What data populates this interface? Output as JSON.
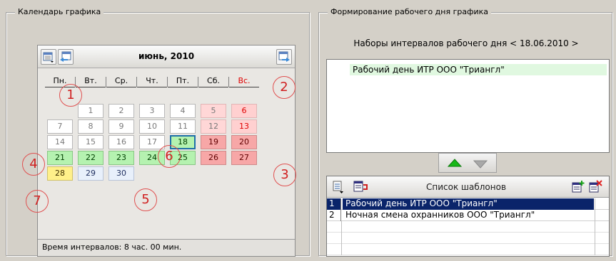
{
  "calendar": {
    "group_title": "Календарь графика",
    "month_title": "июнь, 2010",
    "weekdays": [
      "Пн.",
      "Вт.",
      "Ср.",
      "Чт.",
      "Пт.",
      "Сб.",
      "Вс."
    ],
    "days": [
      {
        "label": "1",
        "style": "plain"
      },
      {
        "label": "2",
        "style": "plain"
      },
      {
        "label": "3",
        "style": "plain"
      },
      {
        "label": "4",
        "style": "plain"
      },
      {
        "label": "5",
        "style": "holiday-soft"
      },
      {
        "label": "6",
        "style": "holiday-red"
      },
      {
        "label": "7",
        "style": "plain"
      },
      {
        "label": "8",
        "style": "plain"
      },
      {
        "label": "9",
        "style": "plain"
      },
      {
        "label": "10",
        "style": "plain"
      },
      {
        "label": "11",
        "style": "plain"
      },
      {
        "label": "12",
        "style": "holiday-soft"
      },
      {
        "label": "13",
        "style": "holiday-red"
      },
      {
        "label": "14",
        "style": "plain"
      },
      {
        "label": "15",
        "style": "plain"
      },
      {
        "label": "16",
        "style": "plain"
      },
      {
        "label": "17",
        "style": "plain"
      },
      {
        "label": "18",
        "style": "today"
      },
      {
        "label": "19",
        "style": "holiday"
      },
      {
        "label": "20",
        "style": "holiday"
      },
      {
        "label": "21",
        "style": "work-green"
      },
      {
        "label": "22",
        "style": "work-green"
      },
      {
        "label": "23",
        "style": "work-green"
      },
      {
        "label": "24",
        "style": "work-green"
      },
      {
        "label": "25",
        "style": "work-green"
      },
      {
        "label": "26",
        "style": "holiday"
      },
      {
        "label": "27",
        "style": "holiday"
      },
      {
        "label": "28",
        "style": "yellow"
      },
      {
        "label": "29",
        "style": "work-pale"
      },
      {
        "label": "30",
        "style": "work-pale"
      }
    ],
    "status_text": "Время интервалов:  8 час. 00 мин.",
    "annotations": [
      "1",
      "2",
      "3",
      "4",
      "5",
      "6",
      "7"
    ]
  },
  "day_forming": {
    "group_title": "Формирование рабочего дня графика",
    "intervals_caption": "Наборы интервалов рабочего дня < 18.06.2010 >",
    "interval_sets": [
      "Рабочий день ИТР ООО \"Триангл\""
    ]
  },
  "templates": {
    "title": "Список шаблонов",
    "rows": [
      {
        "num": "1",
        "name": "Рабочий день ИТР ООО \"Триангл\"",
        "selected": true
      },
      {
        "num": "2",
        "name": "Ночная смена охранников ООО \"Триангл\"",
        "selected": false
      }
    ]
  },
  "colors": {
    "selection": "#0a246a",
    "work_day": "#b5f2b0",
    "holiday": "#f7a7a7",
    "annotation": "#e05050"
  },
  "icons": {
    "calendar_menu": "calendar-dropdown-icon",
    "prev_month": "calendar-prev-icon",
    "next_month": "calendar-next-icon",
    "move_up": "green-triangle-up-icon",
    "move_down": "gray-triangle-down-icon",
    "template_menu": "list-dropdown-icon",
    "template_apply": "template-apply-icon",
    "template_add": "template-add-icon",
    "template_delete": "template-delete-icon"
  }
}
